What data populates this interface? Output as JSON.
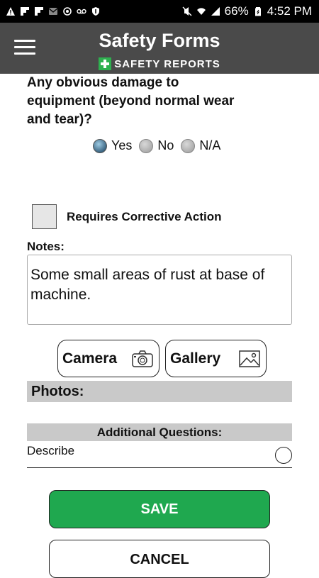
{
  "status_bar": {
    "battery": "66%",
    "time": "4:52 PM",
    "left_icons": [
      "warning-icon",
      "flipboard-icon",
      "flipboard-icon",
      "gmail-icon",
      "sync-icon",
      "voicemail-icon",
      "shield-icon"
    ],
    "right_icons": [
      "mute-icon",
      "wifi-icon",
      "signal-icon",
      "battery-icon"
    ]
  },
  "header": {
    "title": "Safety Forms",
    "brand": "SAFETY REPORTS",
    "brand_color": "#2eb04f",
    "background": "#4a4a4a"
  },
  "question": {
    "text": "Any obvious damage to equipment (beyond normal wear and tear)?",
    "options": [
      "Yes",
      "No",
      "N/A"
    ],
    "selected": "Yes"
  },
  "corrective": {
    "label": "Requires Corrective Action",
    "checked": false
  },
  "notes": {
    "label": "Notes:",
    "value": "Some small areas of rust at base of machine."
  },
  "media": {
    "camera_label": "Camera",
    "gallery_label": "Gallery"
  },
  "photos": {
    "label": "Photos:"
  },
  "additional": {
    "header": "Additional Questions:",
    "items": [
      {
        "label": "Describe",
        "selected": false
      }
    ]
  },
  "actions": {
    "save_label": "SAVE",
    "cancel_label": "CANCEL",
    "save_color": "#1fa84f"
  }
}
